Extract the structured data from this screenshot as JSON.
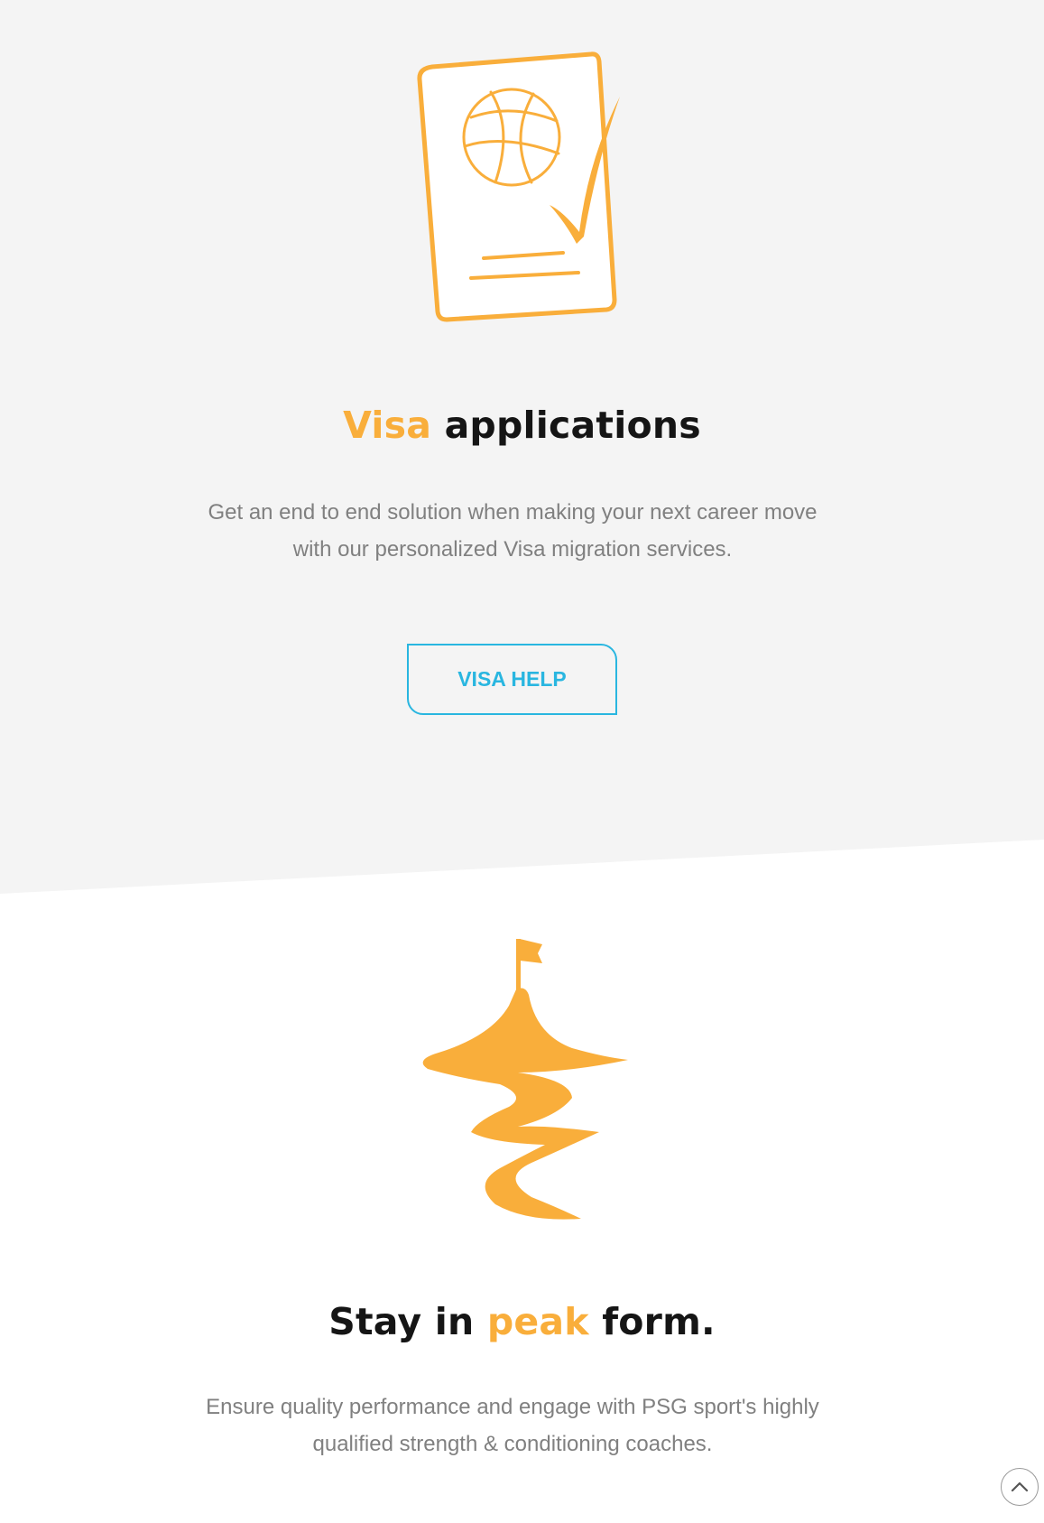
{
  "visa_section": {
    "icon": "passport-check-icon",
    "heading_accent": "Visa",
    "heading_rest": " applications",
    "description": "Get an end to end solution when making your next career move with our personalized Visa migration services.",
    "button_label": "VISA HELP"
  },
  "peak_section": {
    "icon": "mountain-flag-icon",
    "heading_pre": "Stay in ",
    "heading_accent": "peak",
    "heading_post": " form.",
    "description": "Ensure quality performance and engage with PSG sport's highly qualified strength & conditioning coaches."
  },
  "scroll_top": {
    "icon": "chevron-up-icon"
  },
  "colors": {
    "accent": "#f9ae3b",
    "button": "#29b6e0",
    "text": "#151515",
    "muted": "#808080",
    "section_bg": "#f4f4f4"
  }
}
